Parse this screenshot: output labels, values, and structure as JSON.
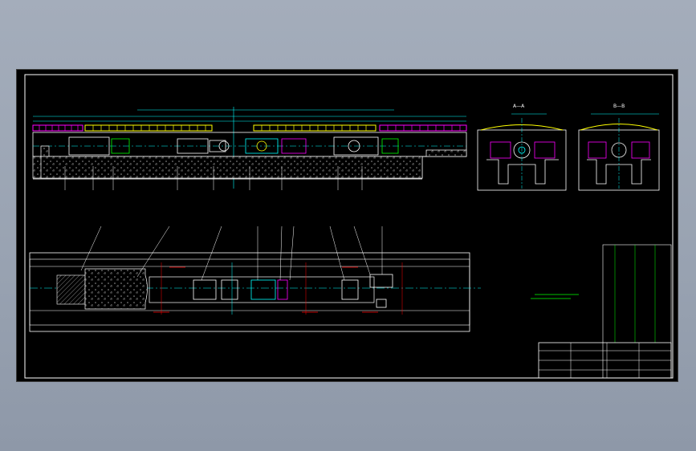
{
  "views": {
    "section_a": {
      "title": "A—A"
    },
    "section_b": {
      "title": "B—B"
    }
  },
  "colors": {
    "background": "#000000",
    "frame": "#ffffff",
    "centerline": "#00ffff",
    "yellow_part": "#ffff00",
    "magenta_part": "#ff00ff",
    "table_text": "#00ff00",
    "annotation_red": "#ff0000"
  },
  "icons": [
    "drawing-frame",
    "elevation-view",
    "section-a-view",
    "section-b-view",
    "plan-view",
    "parts-table",
    "title-block"
  ]
}
